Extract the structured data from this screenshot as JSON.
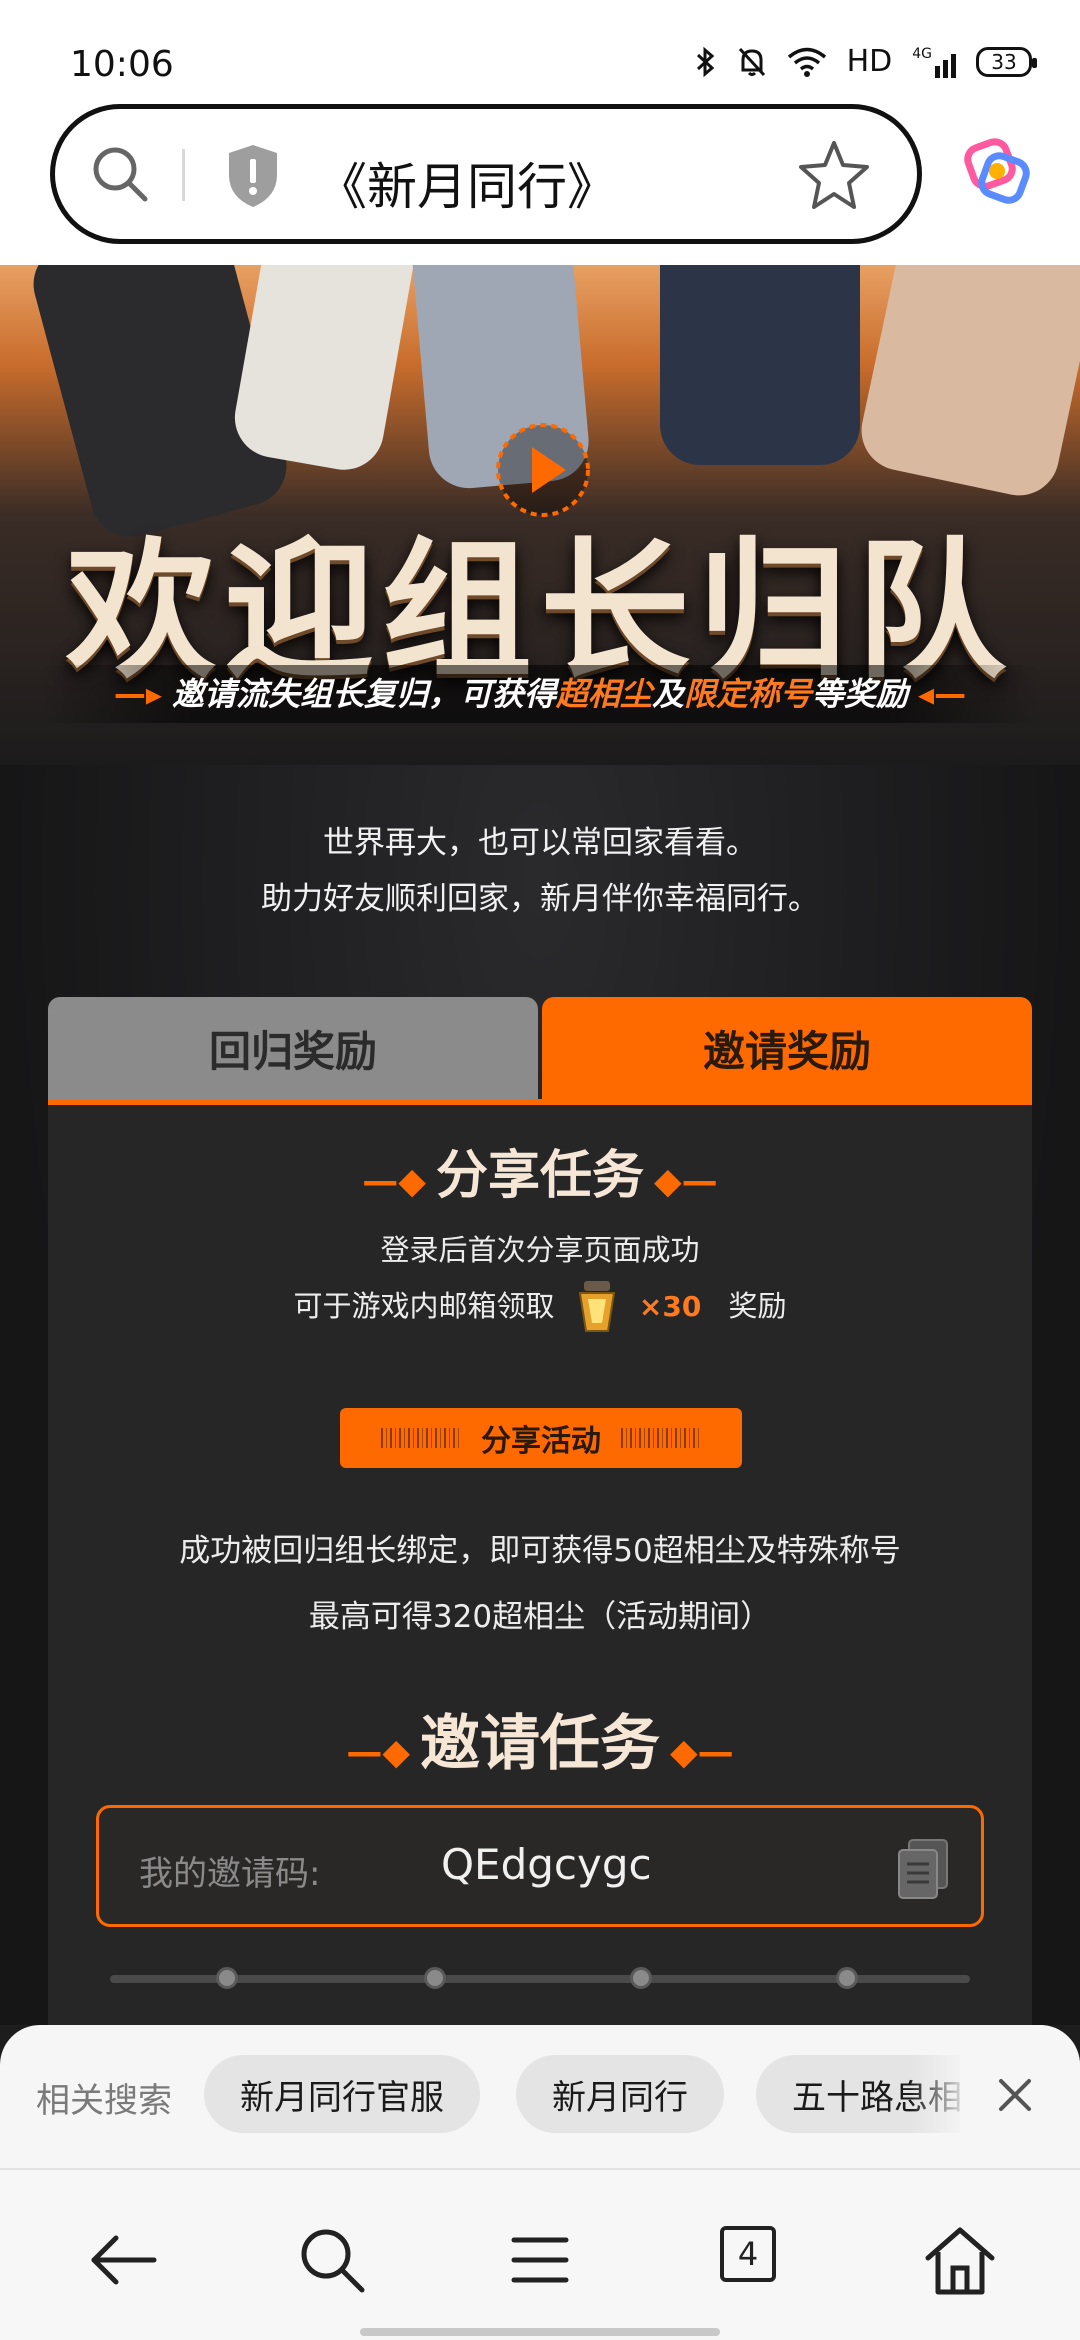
{
  "status_bar": {
    "time": "10:06",
    "network": "HD",
    "signal_label": "4G",
    "battery": "33"
  },
  "browser": {
    "address_title": "《新月同行》",
    "icons": [
      "search-icon",
      "shield-icon",
      "star-icon",
      "browser-logo-icon"
    ]
  },
  "hero": {
    "title": "欢迎组长归队",
    "subtitle_pre": "邀请流失组长复归，可获得",
    "subtitle_hl1": "超相尘",
    "subtitle_mid": "及",
    "subtitle_hl2": "限定称号",
    "subtitle_post": "等奖励"
  },
  "intro": {
    "line1": "世界再大，也可以常回家看看。",
    "line2": "助力好友顺利回家，新月伴你幸福同行。"
  },
  "tabs": {
    "return_label": "回归奖励",
    "invite_label": "邀请奖励",
    "active": "invite"
  },
  "share_task": {
    "title": "分享任务",
    "line1": "登录后首次分享页面成功",
    "line2_pre": "可于游戏内邮箱领取",
    "reward_count": "×30",
    "line2_post": "奖励",
    "button_label": "分享活动"
  },
  "bind_info": {
    "line1": "成功被回归组长绑定，即可获得50超相尘及特殊称号",
    "line2": "最高可得320超相尘（活动期间）"
  },
  "invite_task": {
    "title": "邀请任务",
    "code_label": "我的邀请码:",
    "code_value": "QEdgcygc"
  },
  "related_search": {
    "label": "相关搜索",
    "chips": [
      "新月同行官服",
      "新月同行",
      "五十路息相"
    ]
  },
  "bottom_nav": {
    "tab_count": "4",
    "icons": [
      "back-arrow-icon",
      "search-icon",
      "menu-icon",
      "tabs-icon",
      "home-icon"
    ]
  },
  "colors": {
    "accent": "#ff6a00",
    "tab_inactive": "#8b8b8b",
    "panel": "#262627"
  }
}
